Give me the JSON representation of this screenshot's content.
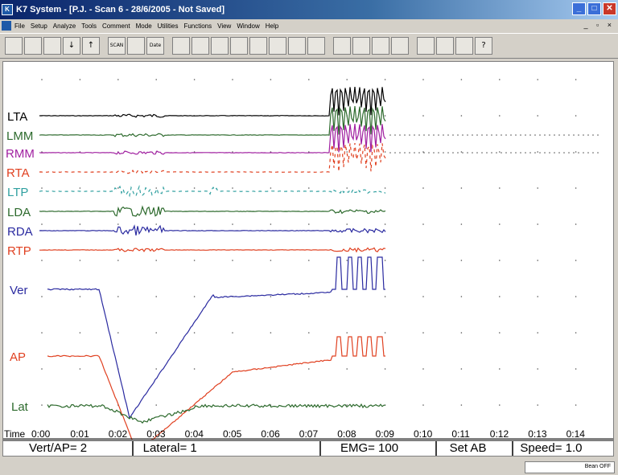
{
  "window": {
    "title": "K7 System - [P.J. - Scan 6 - 28/6/2005 - Not Saved]",
    "buttons": [
      "_",
      "□",
      "✕"
    ]
  },
  "menubar": {
    "items": [
      "File",
      "Setup",
      "Analyze",
      "Tools",
      "Comment",
      "Mode",
      "Utilities",
      "Functions",
      "View",
      "Window",
      "Help"
    ],
    "mdi_controls": "_ ▫ ×"
  },
  "toolbar": {
    "buttons": [
      "new",
      "open",
      "save",
      "down-arrow",
      "up-arrow",
      "scan",
      "delete",
      "calendar",
      "view-1",
      "view-2",
      "edit",
      "chart-1",
      "chart-2",
      "chart-3",
      "camera",
      "report",
      "floppy-1",
      "floppy-2",
      "floppy-3",
      "print",
      "layout-1",
      "layout-2",
      "layout-3",
      "help"
    ],
    "labels": [
      "",
      "",
      "",
      "↓",
      "↑",
      "SCAN",
      "",
      "Date",
      "",
      "",
      "",
      "",
      "",
      "",
      "",
      "",
      "",
      "",
      "",
      "",
      "",
      "",
      "",
      "?"
    ]
  },
  "traces": [
    {
      "label": "LTA",
      "color": "#000000"
    },
    {
      "label": "LMM",
      "color": "#2d6a2d"
    },
    {
      "label": "RMM",
      "color": "#a020a0"
    },
    {
      "label": "RTA",
      "color": "#e04020"
    },
    {
      "label": "LTP",
      "color": "#30a0a0"
    },
    {
      "label": "LDA",
      "color": "#2d6a2d"
    },
    {
      "label": "RDA",
      "color": "#2a2aa0"
    },
    {
      "label": "RTP",
      "color": "#e04020"
    },
    {
      "label": "Ver",
      "color": "#2a2aa0"
    },
    {
      "label": "AP",
      "color": "#e04020"
    },
    {
      "label": "Lat",
      "color": "#2d6a2d"
    }
  ],
  "time_axis": {
    "label": "Time",
    "ticks": [
      "0:00",
      "0:01",
      "0:02",
      "0:03",
      "0:04",
      "0:05",
      "0:06",
      "0:07",
      "0:08",
      "0:09",
      "0:10",
      "0:11",
      "0:12",
      "0:13",
      "0:14"
    ]
  },
  "status": {
    "vert_ap": "Vert/AP= 2",
    "lateral": "Lateral= 1",
    "emg": "EMG= 100",
    "set": "Set AB",
    "speed": "Speed= 1.0"
  },
  "footer": {
    "label": "Bean OFF"
  }
}
